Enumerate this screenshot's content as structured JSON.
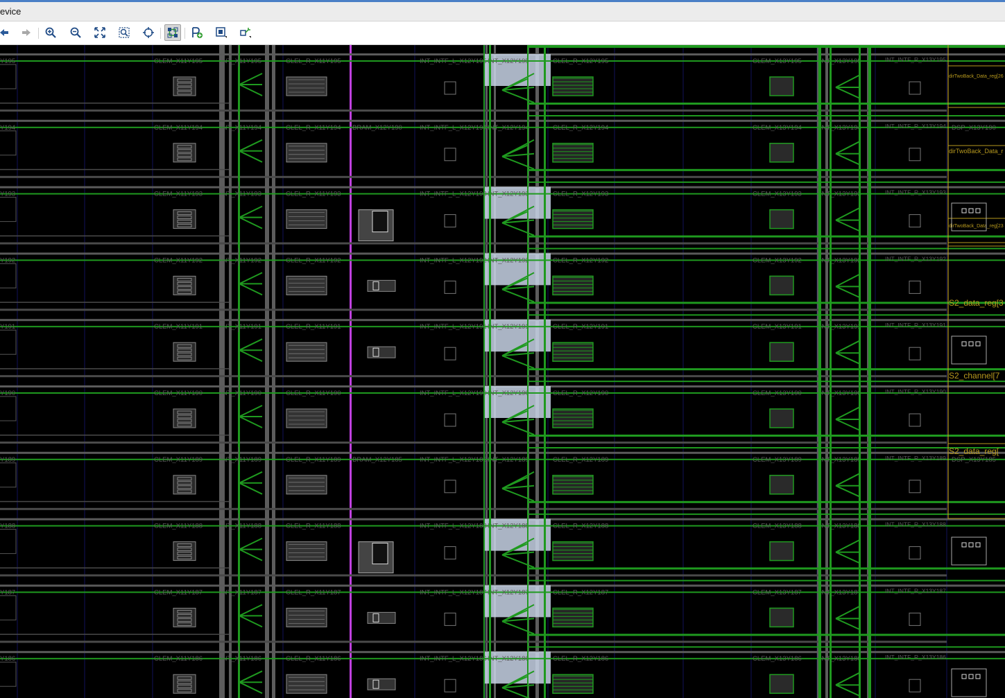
{
  "window": {
    "title": "evice"
  },
  "toolbar": {
    "buttons": [
      {
        "name": "back-button",
        "icon": "arrow-left-icon"
      },
      {
        "name": "forward-button",
        "icon": "arrow-right-icon"
      },
      {
        "name": "zoom-in-button",
        "icon": "zoom-in-icon"
      },
      {
        "name": "zoom-out-button",
        "icon": "zoom-out-icon"
      },
      {
        "name": "zoom-fit-button",
        "icon": "fit-icon"
      },
      {
        "name": "zoom-selected-button",
        "icon": "zoom-area-icon"
      },
      {
        "name": "auto-fit-selection-button",
        "icon": "crosshair-icon"
      },
      {
        "name": "routing-resources-button",
        "icon": "routing-icon",
        "active": true
      },
      {
        "name": "add-pblock-button",
        "icon": "pblock-add-icon"
      },
      {
        "name": "draw-pblock-button",
        "icon": "pblock-draw-icon"
      },
      {
        "name": "fixed-cells-button",
        "icon": "fixed-cells-icon"
      }
    ]
  },
  "device": {
    "rows": [
      {
        "row": "195",
        "left": "Y195",
        "clem": "CLEM_X11Y195",
        "int_a": "INT_X11Y195",
        "clel_r": "CLEL_R_X11Y195",
        "bram": "",
        "intf_l": "INT_INTF_L_X12Y195",
        "int_b": "INT_X12Y195",
        "clel_r2": "CLEL_R_X12Y195",
        "clem2": "CLEM_X13Y195",
        "int_c": "INT_X13Y195",
        "intf_r": "INT_INTF_R_X13Y195",
        "dsp": ""
      },
      {
        "row": "194",
        "left": "Y194",
        "clem": "CLEM_X11Y194",
        "int_a": "INT_X11Y194",
        "clel_r": "CLEL_R_X11Y194",
        "bram": "BRAM_X12Y190",
        "intf_l": "INT_INTF_L_X12Y194",
        "int_b": "INT_X12Y194",
        "clel_r2": "CLEL_R_X12Y194",
        "clem2": "CLEM_X13Y194",
        "int_c": "INT_X13Y194",
        "intf_r": "INT_INTF_R_X13Y194",
        "dsp": "DSP_X13Y190"
      },
      {
        "row": "193",
        "left": "Y193",
        "clem": "CLEM_X11Y193",
        "int_a": "INT_X11Y193",
        "clel_r": "CLEL_R_X11Y193",
        "bram": "",
        "intf_l": "INT_INTF_L_X12Y193",
        "int_b": "INT_X12Y193",
        "clel_r2": "CLEL_R_X12Y193",
        "clem2": "CLEM_X13Y193",
        "int_c": "INT_X13Y193",
        "intf_r": "INT_INTF_R_X13Y193",
        "dsp": ""
      },
      {
        "row": "192",
        "left": "Y192",
        "clem": "CLEM_X11Y192",
        "int_a": "INT_X11Y192",
        "clel_r": "CLEL_R_X11Y192",
        "bram": "",
        "intf_l": "INT_INTF_L_X12Y192",
        "int_b": "INT_X12Y192",
        "clel_r2": "CLEL_R_X12Y192",
        "clem2": "CLEM_X13Y192",
        "int_c": "INT_X13Y192",
        "intf_r": "INT_INTF_R_X13Y192",
        "dsp": ""
      },
      {
        "row": "191",
        "left": "Y191",
        "clem": "CLEM_X11Y191",
        "int_a": "INT_X11Y191",
        "clel_r": "CLEL_R_X11Y191",
        "bram": "",
        "intf_l": "INT_INTF_L_X12Y191",
        "int_b": "INT_X12Y191",
        "clel_r2": "CLEL_R_X12Y191",
        "clem2": "CLEM_X13Y191",
        "int_c": "INT_X13Y191",
        "intf_r": "INT_INTF_R_X13Y191",
        "dsp": ""
      },
      {
        "row": "190",
        "left": "Y190",
        "clem": "CLEM_X11Y190",
        "int_a": "INT_X11Y190",
        "clel_r": "CLEL_R_X11Y190",
        "bram": "",
        "intf_l": "INT_INTF_L_X12Y190",
        "int_b": "INT_X12Y190",
        "clel_r2": "CLEL_R_X12Y190",
        "clem2": "CLEM_X13Y190",
        "int_c": "INT_X13Y190",
        "intf_r": "INT_INTF_R_X13Y190",
        "dsp": ""
      },
      {
        "row": "189",
        "left": "Y189",
        "clem": "CLEM_X11Y189",
        "int_a": "INT_X11Y189",
        "clel_r": "CLEL_R_X11Y189",
        "bram": "BRAM_X12Y185",
        "intf_l": "INT_INTF_L_X12Y189",
        "int_b": "INT_X12Y189",
        "clel_r2": "CLEL_R_X12Y189",
        "clem2": "CLEM_X13Y189",
        "int_c": "INT_X13Y189",
        "intf_r": "INT_INTF_R_X13Y189",
        "dsp": "DSP_X13Y185"
      },
      {
        "row": "188",
        "left": "Y188",
        "clem": "CLEM_X11Y188",
        "int_a": "INT_X11Y188",
        "clel_r": "CLEL_R_X11Y188",
        "bram": "",
        "intf_l": "INT_INTF_L_X12Y188",
        "int_b": "INT_X12Y188",
        "clel_r2": "CLEL_R_X12Y188",
        "clem2": "CLEM_X13Y188",
        "int_c": "INT_X13Y188",
        "intf_r": "INT_INTF_R_X13Y188",
        "dsp": ""
      },
      {
        "row": "187",
        "left": "Y187",
        "clem": "CLEM_X11Y187",
        "int_a": "INT_X11Y187",
        "clel_r": "CLEL_R_X11Y187",
        "bram": "",
        "intf_l": "INT_INTF_L_X12Y187",
        "int_b": "INT_X12Y187",
        "clel_r2": "CLEL_R_X12Y187",
        "clem2": "CLEM_X13Y187",
        "int_c": "INT_X13Y187",
        "intf_r": "INT_INTF_R_X13Y187",
        "dsp": ""
      },
      {
        "row": "186",
        "left": "Y186",
        "clem": "CLEM_X11Y186",
        "int_a": "INT_X11Y186",
        "clel_r": "CLEL_R_X11Y186",
        "bram": "",
        "intf_l": "INT_INTF_L_X12Y186",
        "int_b": "INT_X12Y186",
        "clel_r2": "CLEL_R_X12Y186",
        "clem2": "CLEM_X13Y186",
        "int_c": "INT_X13Y186",
        "intf_r": "INT_INTF_R_X13Y186",
        "dsp": ""
      }
    ],
    "cell_labels": [
      {
        "text": "dirTwoBack_Data_reg[26"
      },
      {
        "text": "dirTwoBack_Data_r"
      },
      {
        "text": "dirTwoBack_Data_reg[23"
      },
      {
        "text": "S2_data_reg[3"
      },
      {
        "text": "S2_channel[7"
      },
      {
        "text": "S2_data_reg["
      }
    ],
    "colors": {
      "route": "#1f9a1f",
      "tile_text": "#5a5a5a",
      "site": "#8a8a8a",
      "highlight": "#c8d4e6",
      "bram_column": "#c040e0",
      "cell_box": "#b89a1e",
      "grid_line": "#12125a"
    }
  }
}
